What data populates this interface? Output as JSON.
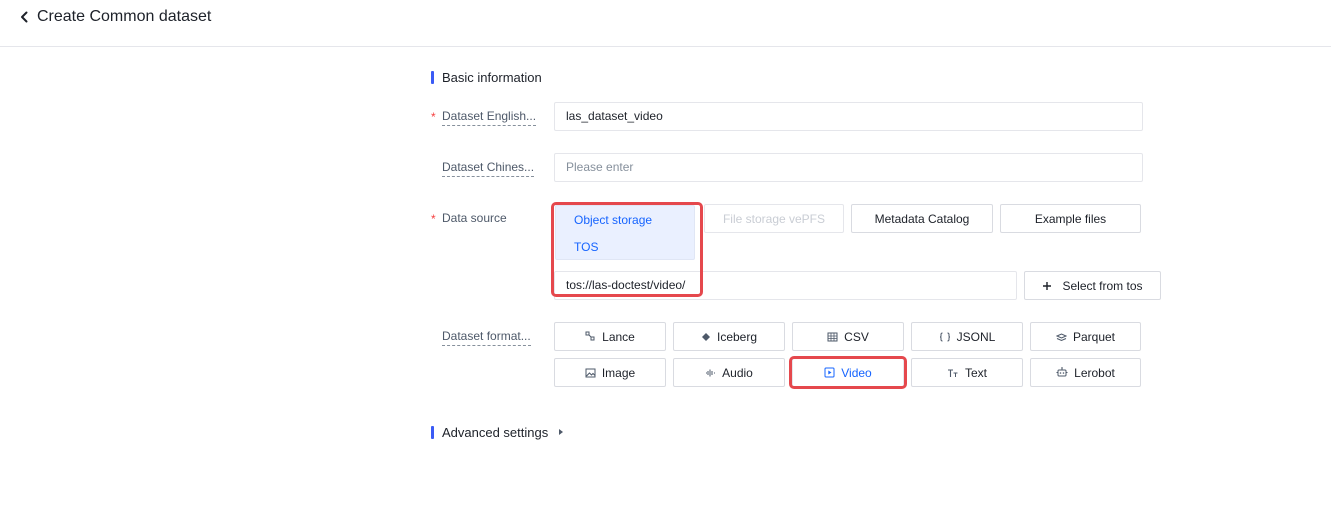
{
  "header": {
    "title": "Create Common dataset"
  },
  "basic_info": {
    "title": "Basic information"
  },
  "fields": {
    "english_name": {
      "label": "Dataset English...",
      "value": "las_dataset_video"
    },
    "chinese_name": {
      "label": "Dataset Chines...",
      "placeholder": "Please enter"
    },
    "data_source": {
      "label": "Data source",
      "options": {
        "object_storage": "Object storage",
        "file_storage": "File storage vePFS",
        "metadata_catalog": "Metadata Catalog",
        "example_files": "Example files"
      },
      "sub_option": "TOS",
      "path": "tos://las-doctest/video/",
      "select_button": "Select from tos"
    },
    "dataset_format": {
      "label": "Dataset format...",
      "options": {
        "lance": "Lance",
        "iceberg": "Iceberg",
        "csv": "CSV",
        "jsonl": "JSONL",
        "parquet": "Parquet",
        "image": "Image",
        "audio": "Audio",
        "video": "Video",
        "text": "Text",
        "lerobot": "Lerobot"
      },
      "selected": "Video"
    }
  },
  "advanced": {
    "title": "Advanced settings"
  },
  "colors": {
    "accent": "#1664ff",
    "section_bar": "#3b5bf5",
    "highlight": "#e5484d",
    "required": "#f53f3f"
  }
}
